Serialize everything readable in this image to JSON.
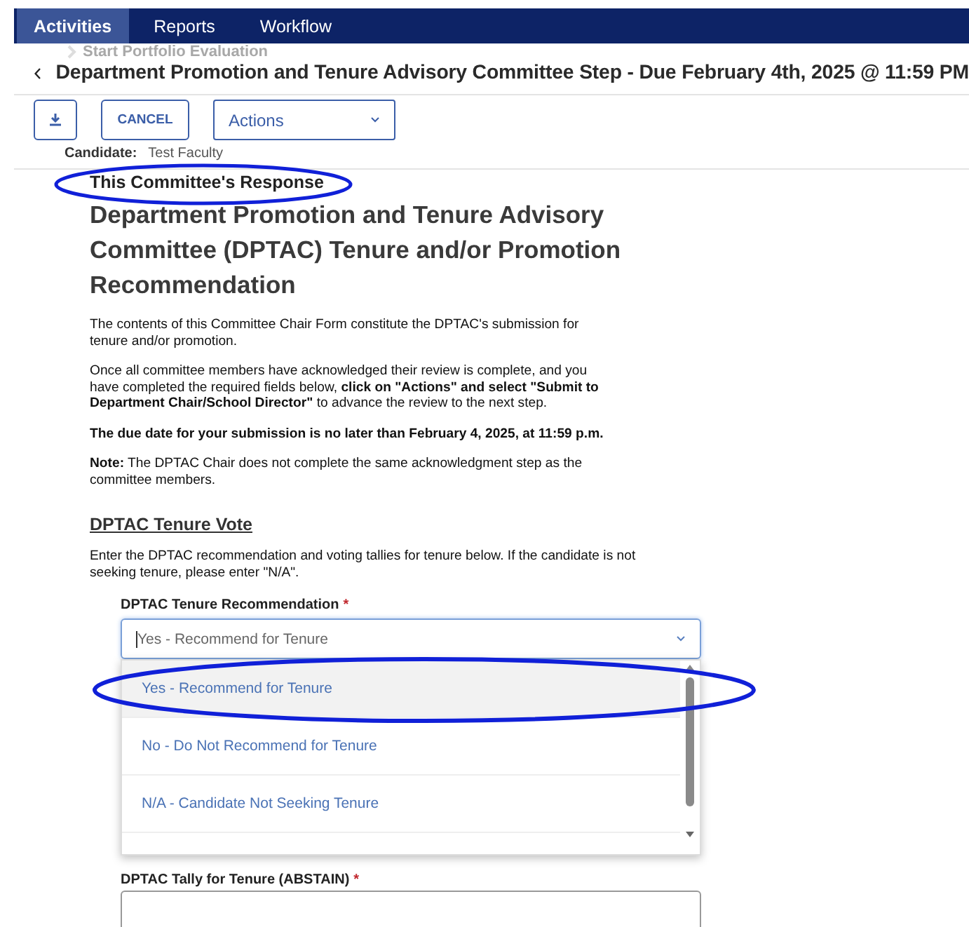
{
  "nav": {
    "tabs": [
      {
        "label": "Activities",
        "selected": true
      },
      {
        "label": "Reports",
        "selected": false
      },
      {
        "label": "Workflow",
        "selected": false
      }
    ]
  },
  "breadcrumb_ghost": "Start Portfolio Evaluation",
  "page_title": "Department Promotion and Tenure Advisory Committee Step - Due February 4th, 2025 @ 11:59 PM",
  "toolbar": {
    "cancel": "CANCEL",
    "actions": "Actions"
  },
  "candidate": {
    "label": "Candidate:",
    "value": "Test Faculty"
  },
  "section_title": "This Committee's Response",
  "form_heading": "Department Promotion and Tenure Advisory Committee (DPTAC) Tenure and/or Promotion Recommendation",
  "paragraphs": [
    "The contents of this Committee Chair Form constitute the DPTAC's submission for tenure and/or promotion.",
    "Once all committee members have acknowledged their review is complete, and you have completed the required fields below, **click on \"Actions\" and select \"Submit to Department Chair/School Director\"** to advance the review to the next step.",
    "**The due date for your submission is no later than February 4, 2025, at 11:59 p.m.**",
    "**Note:** The DPTAC Chair does not complete the same acknowledgment step as the committee members."
  ],
  "vote_heading": "DPTAC Tenure Vote",
  "vote_text": "Enter the DPTAC recommendation and voting tallies for tenure below. If the candidate is not seeking tenure, please enter \"N/A\".",
  "recommendation": {
    "label": "DPTAC Tenure Recommendation",
    "required_mark": "*",
    "value": "Yes - Recommend for Tenure",
    "expanded": true,
    "options": [
      {
        "label": "Yes - Recommend for Tenure",
        "selected": true
      },
      {
        "label": "No - Do Not Recommend for Tenure",
        "selected": false
      },
      {
        "label": "N/A - Candidate Not Seeking Tenure",
        "selected": false
      }
    ]
  },
  "abstain": {
    "label": "DPTAC Tally for Tenure (ABSTAIN)",
    "required_mark": "*"
  }
}
